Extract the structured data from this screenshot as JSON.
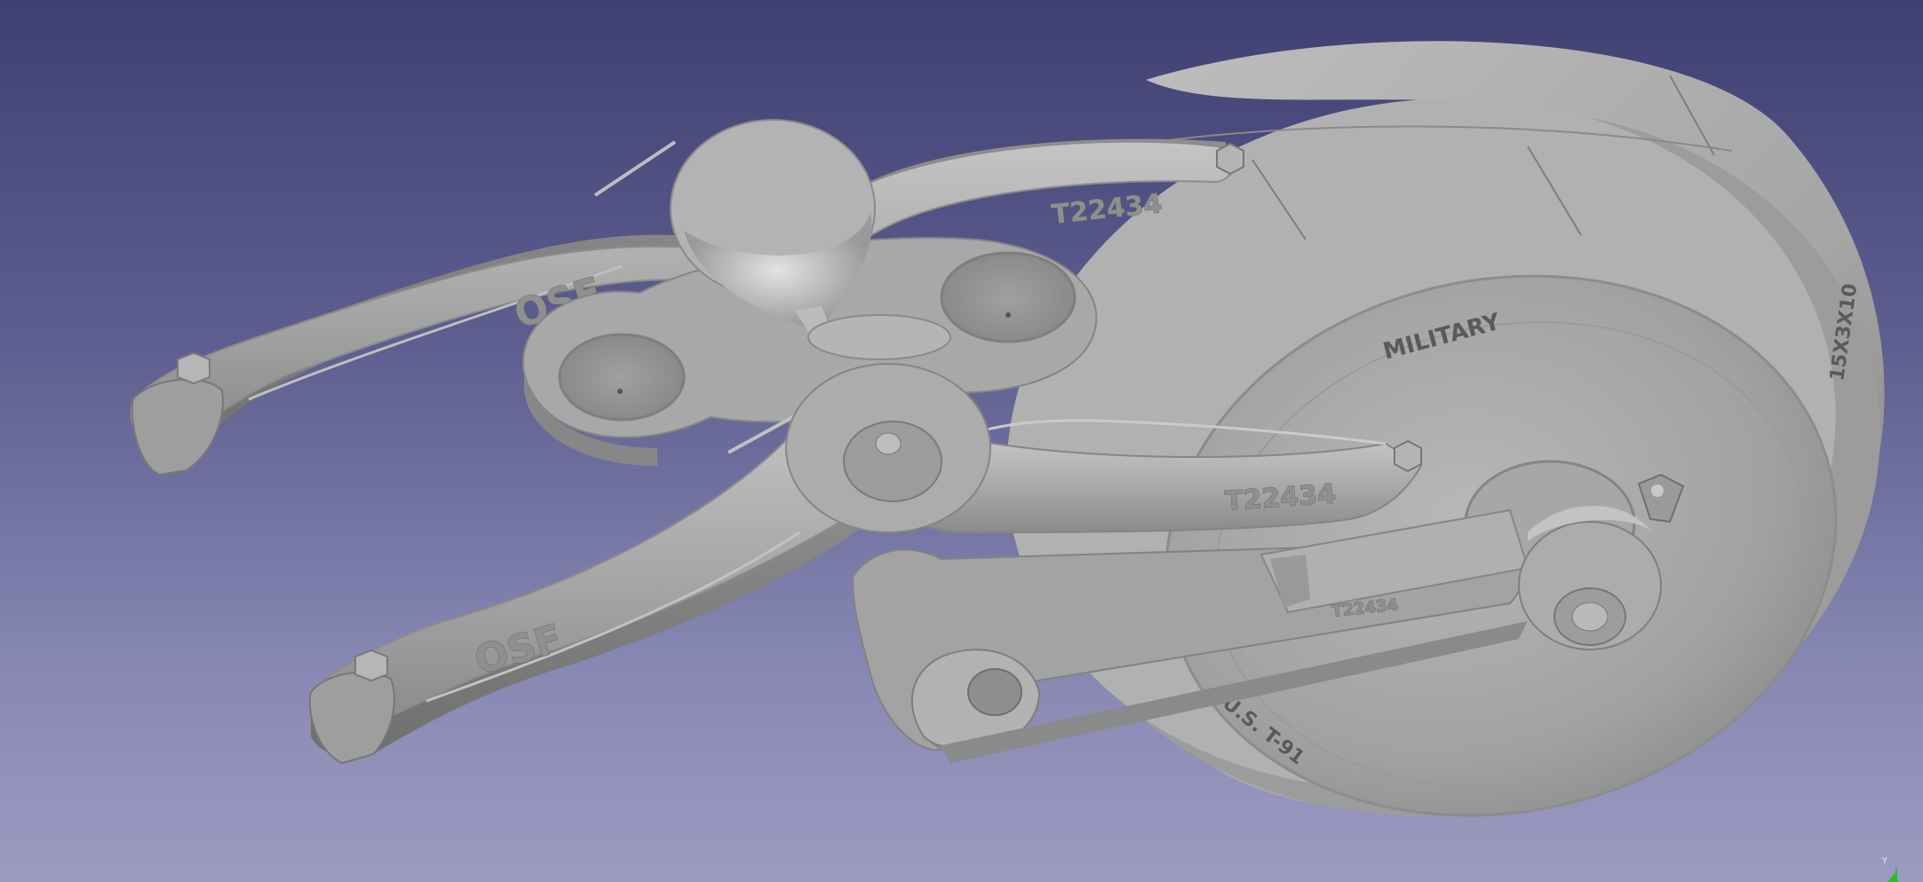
{
  "viewport": {
    "background_top": "#3f3f72",
    "background_bottom": "#9b9bc1",
    "model_color": "#a9a9a9"
  },
  "model": {
    "label_military": "MILITARY",
    "label_part_top": "T22434",
    "label_part_bottom": "T22434",
    "label_osf_top": "OSF",
    "label_osf_bottom": "OSF",
    "label_rim_right": "15X3X10",
    "label_rim_bottom": "U.S. T-91",
    "label_arm_small": "T22434"
  },
  "navigation_cube": {
    "axis_y_label": "Y",
    "axis_y_color": "#2bbf2b"
  }
}
